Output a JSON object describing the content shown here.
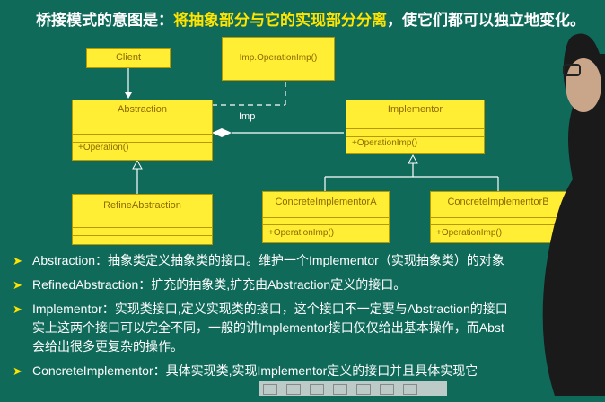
{
  "title": {
    "prefix": "桥接模式的意图是：",
    "highlight": "将抽象部分与它的实现部分分离",
    "suffix": "，使它们都可以独立地变化。"
  },
  "diagram": {
    "client": "Client",
    "note": "Imp.OperationImp()",
    "abstraction": {
      "name": "Abstraction",
      "op": "+Operation()"
    },
    "implementor": {
      "name": "Implementor",
      "op": "+OperationImp()"
    },
    "refine": {
      "name": "RefineAbstraction"
    },
    "concreteA": {
      "name": "ConcreteImplementorA",
      "op": "+OperationImp()"
    },
    "concreteB": {
      "name": "ConcreteImplementorB",
      "op": "+OperationImp()"
    },
    "association_label": "Imp"
  },
  "bullets": [
    {
      "text": "Abstraction：抽象类定义抽象类的接口。维护一个Implementor（实现抽象类）的对象"
    },
    {
      "text": "RefinedAbstraction：扩充的抽象类,扩充由Abstraction定义的接口。"
    },
    {
      "line1": "Implementor：实现类接口,定义实现类的接口，这个接口不一定要与Abstraction的接口",
      "line2": "实上这两个接口可以完全不同，一般的讲Implementor接口仅仅给出基本操作，而Abst",
      "line3": "会给出很多更复杂的操作。"
    },
    {
      "text": "ConcreteImplementor：具体实现类,实现Implementor定义的接口并且具体实现它"
    }
  ],
  "colors": {
    "background": "#0f6a5a",
    "box": "#ffee33",
    "highlight": "#ffe400"
  }
}
